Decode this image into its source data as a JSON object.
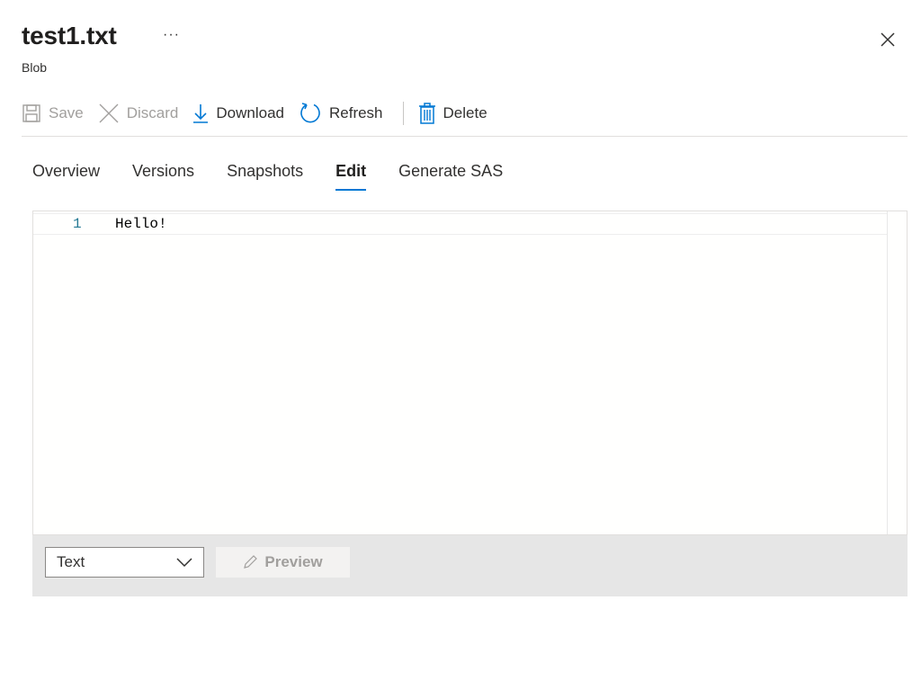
{
  "header": {
    "title": "test1.txt",
    "more_label": "···",
    "subtitle": "Blob",
    "close_icon": "close-icon"
  },
  "toolbar": {
    "save_label": "Save",
    "discard_label": "Discard",
    "download_label": "Download",
    "refresh_label": "Refresh",
    "delete_label": "Delete",
    "icons": [
      "save-icon",
      "discard-icon",
      "download-icon",
      "refresh-icon",
      "delete-icon"
    ],
    "accent_color": "#0078d4"
  },
  "tabs": [
    {
      "label": "Overview",
      "active": false
    },
    {
      "label": "Versions",
      "active": false
    },
    {
      "label": "Snapshots",
      "active": false
    },
    {
      "label": "Edit",
      "active": true
    },
    {
      "label": "Generate SAS",
      "active": false
    }
  ],
  "editor": {
    "lines": [
      {
        "number": "1",
        "text": "Hello!"
      }
    ]
  },
  "footer": {
    "language_select_value": "Text",
    "preview_label": "Preview",
    "icons": [
      "chevron-down-icon",
      "pencil-icon"
    ]
  }
}
